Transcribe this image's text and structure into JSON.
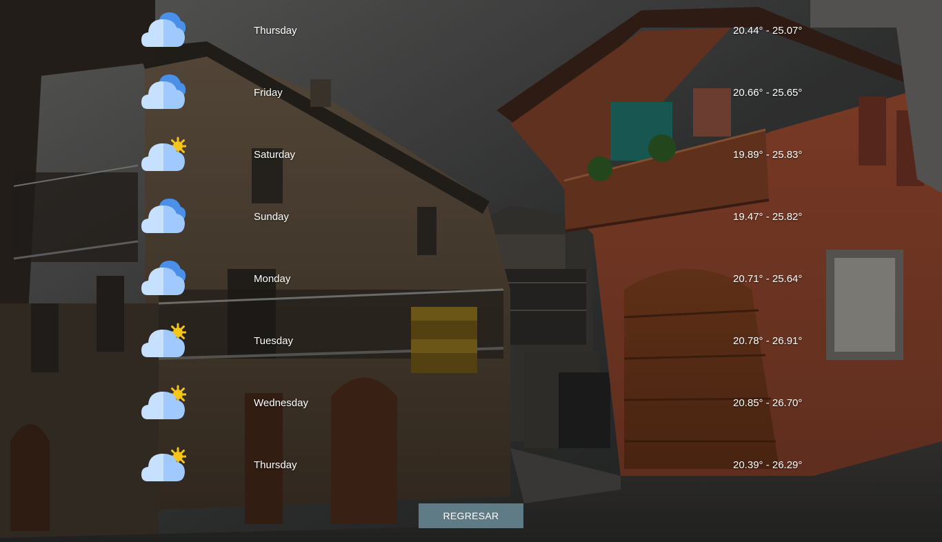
{
  "forecast": [
    {
      "day": "Thursday",
      "range": "20.44° - 25.07°",
      "icon": "cloudy-icon"
    },
    {
      "day": "Friday",
      "range": "20.66° - 25.65°",
      "icon": "cloudy-icon"
    },
    {
      "day": "Saturday",
      "range": "19.89° - 25.83°",
      "icon": "partly-cloudy-icon"
    },
    {
      "day": "Sunday",
      "range": "19.47° - 25.82°",
      "icon": "cloudy-icon"
    },
    {
      "day": "Monday",
      "range": "20.71° - 25.64°",
      "icon": "cloudy-icon"
    },
    {
      "day": "Tuesday",
      "range": "20.78° - 26.91°",
      "icon": "partly-cloudy-icon"
    },
    {
      "day": "Wednesday",
      "range": "20.85° - 26.70°",
      "icon": "partly-cloudy-icon"
    },
    {
      "day": "Thursday",
      "range": "20.39° - 26.29°",
      "icon": "partly-cloudy-icon"
    }
  ],
  "actions": {
    "back_label": "REGRESAR"
  },
  "colors": {
    "button_bg": "#5f7c86",
    "text": "#ffffff",
    "cloud_light": "#c6e0ff",
    "cloud_mid": "#9fc9ff",
    "cloud_back": "#4a90e8",
    "sun": "#f5c518"
  }
}
